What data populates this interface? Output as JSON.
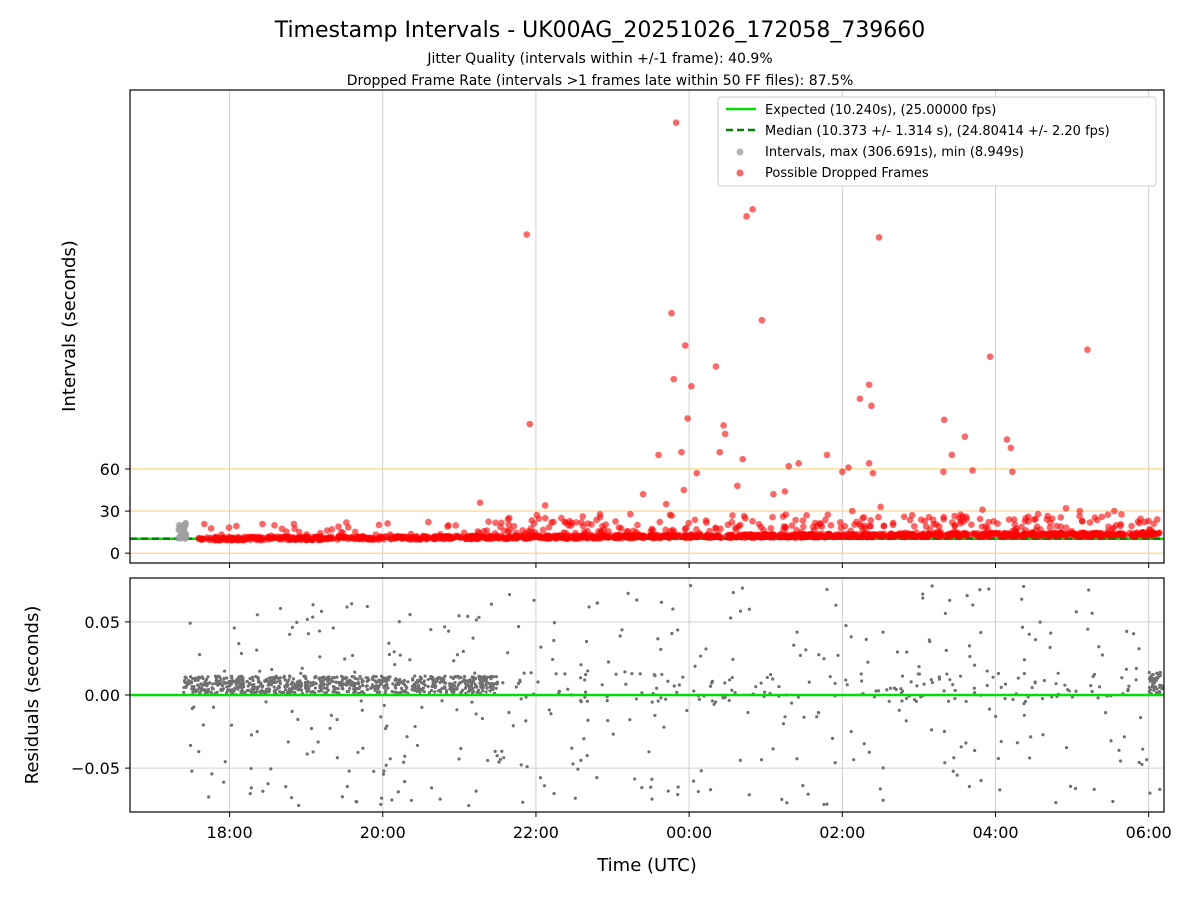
{
  "figure": {
    "title": "Timestamp Intervals - UK00AG_20251026_172058_739660",
    "subtitle_1": "Jitter Quality (intervals within +/-1 frame): 40.9%",
    "subtitle_2": "Dropped Frame Rate (intervals >1 frames late within 50 FF files): 87.5%"
  },
  "colors": {
    "expected": "#00e000",
    "median": "#008000",
    "intervals": "#a0a0a0",
    "dropped": "#ff0000",
    "residuals": "#707070",
    "hline": "#ffd27f",
    "grid": "#d0d0d0"
  },
  "chart_data": [
    {
      "type": "scatter",
      "panel": "top",
      "xlabel": "",
      "ylabel": "Intervals (seconds)",
      "xlim_hours": [
        16.7,
        30.2
      ],
      "ylim": [
        -7,
        330
      ],
      "yticks": [
        0,
        30,
        60
      ],
      "ytick_labels": [
        "0",
        "30",
        "60"
      ],
      "reference_lines": [
        0,
        30,
        60
      ],
      "expected_interval": 10.24,
      "median_interval": 10.373,
      "legend": {
        "placement": "top-right",
        "entries": [
          "Expected (10.240s), (25.00000 fps)",
          "Median (10.373 +/- 1.314 s), (24.80414 +/- 2.20 fps)",
          "Intervals, max (306.691s), min (8.949s)",
          "Possible Dropped Frames"
        ]
      },
      "outliers_hours_seconds": [
        [
          23.83,
          306.7
        ],
        [
          21.88,
          227
        ],
        [
          24.75,
          240
        ],
        [
          24.83,
          245
        ],
        [
          24.95,
          166
        ],
        [
          26.48,
          225
        ],
        [
          23.77,
          171
        ],
        [
          23.95,
          148
        ],
        [
          24.35,
          133
        ],
        [
          23.8,
          124
        ],
        [
          24.03,
          119
        ],
        [
          23.98,
          96
        ],
        [
          21.92,
          92
        ],
        [
          26.23,
          110
        ],
        [
          26.35,
          120
        ],
        [
          26.38,
          105
        ],
        [
          29.2,
          145
        ],
        [
          27.93,
          140
        ],
        [
          27.33,
          95
        ],
        [
          27.6,
          83
        ],
        [
          24.45,
          91
        ],
        [
          24.4,
          72
        ],
        [
          23.6,
          70
        ],
        [
          23.9,
          72
        ],
        [
          24.47,
          85
        ],
        [
          24.7,
          67
        ],
        [
          25.3,
          62
        ],
        [
          25.43,
          64
        ],
        [
          25.8,
          70
        ],
        [
          26.0,
          58
        ],
        [
          26.08,
          61
        ],
        [
          26.35,
          64
        ],
        [
          26.4,
          57
        ],
        [
          27.32,
          58
        ],
        [
          27.43,
          70
        ],
        [
          27.7,
          59
        ],
        [
          28.15,
          81
        ],
        [
          28.2,
          75
        ],
        [
          28.22,
          58
        ],
        [
          24.1,
          57
        ],
        [
          23.7,
          35
        ],
        [
          23.93,
          45
        ],
        [
          24.63,
          48
        ],
        [
          25.1,
          42
        ],
        [
          25.25,
          44
        ],
        [
          21.27,
          36
        ],
        [
          22.12,
          34
        ],
        [
          23.4,
          42
        ],
        [
          26.13,
          30
        ],
        [
          26.5,
          33
        ],
        [
          27.83,
          31
        ],
        [
          28.43,
          26
        ],
        [
          28.92,
          32
        ],
        [
          29.1,
          30
        ],
        [
          29.55,
          30
        ]
      ],
      "note_series": "Dense band of red dropped-frame points near 10-14 s from 17:35 to 06:10; grey interval points near 10-22 s at 17:25"
    },
    {
      "type": "scatter",
      "panel": "bottom",
      "xlabel": "Time (UTC)",
      "ylabel": "Residuals (seconds)",
      "xlim_hours": [
        16.7,
        30.2
      ],
      "ylim": [
        -0.08,
        0.08
      ],
      "yticks": [
        -0.05,
        0.0,
        0.05
      ],
      "ytick_labels": [
        "−0.05",
        "0.00",
        "0.05"
      ],
      "xticks_hours": [
        18,
        20,
        22,
        24,
        26,
        28,
        30
      ],
      "xtick_labels": [
        "18:00",
        "20:00",
        "22:00",
        "00:00",
        "02:00",
        "04:00",
        "06:00"
      ],
      "zero_line": 0.0
    }
  ]
}
